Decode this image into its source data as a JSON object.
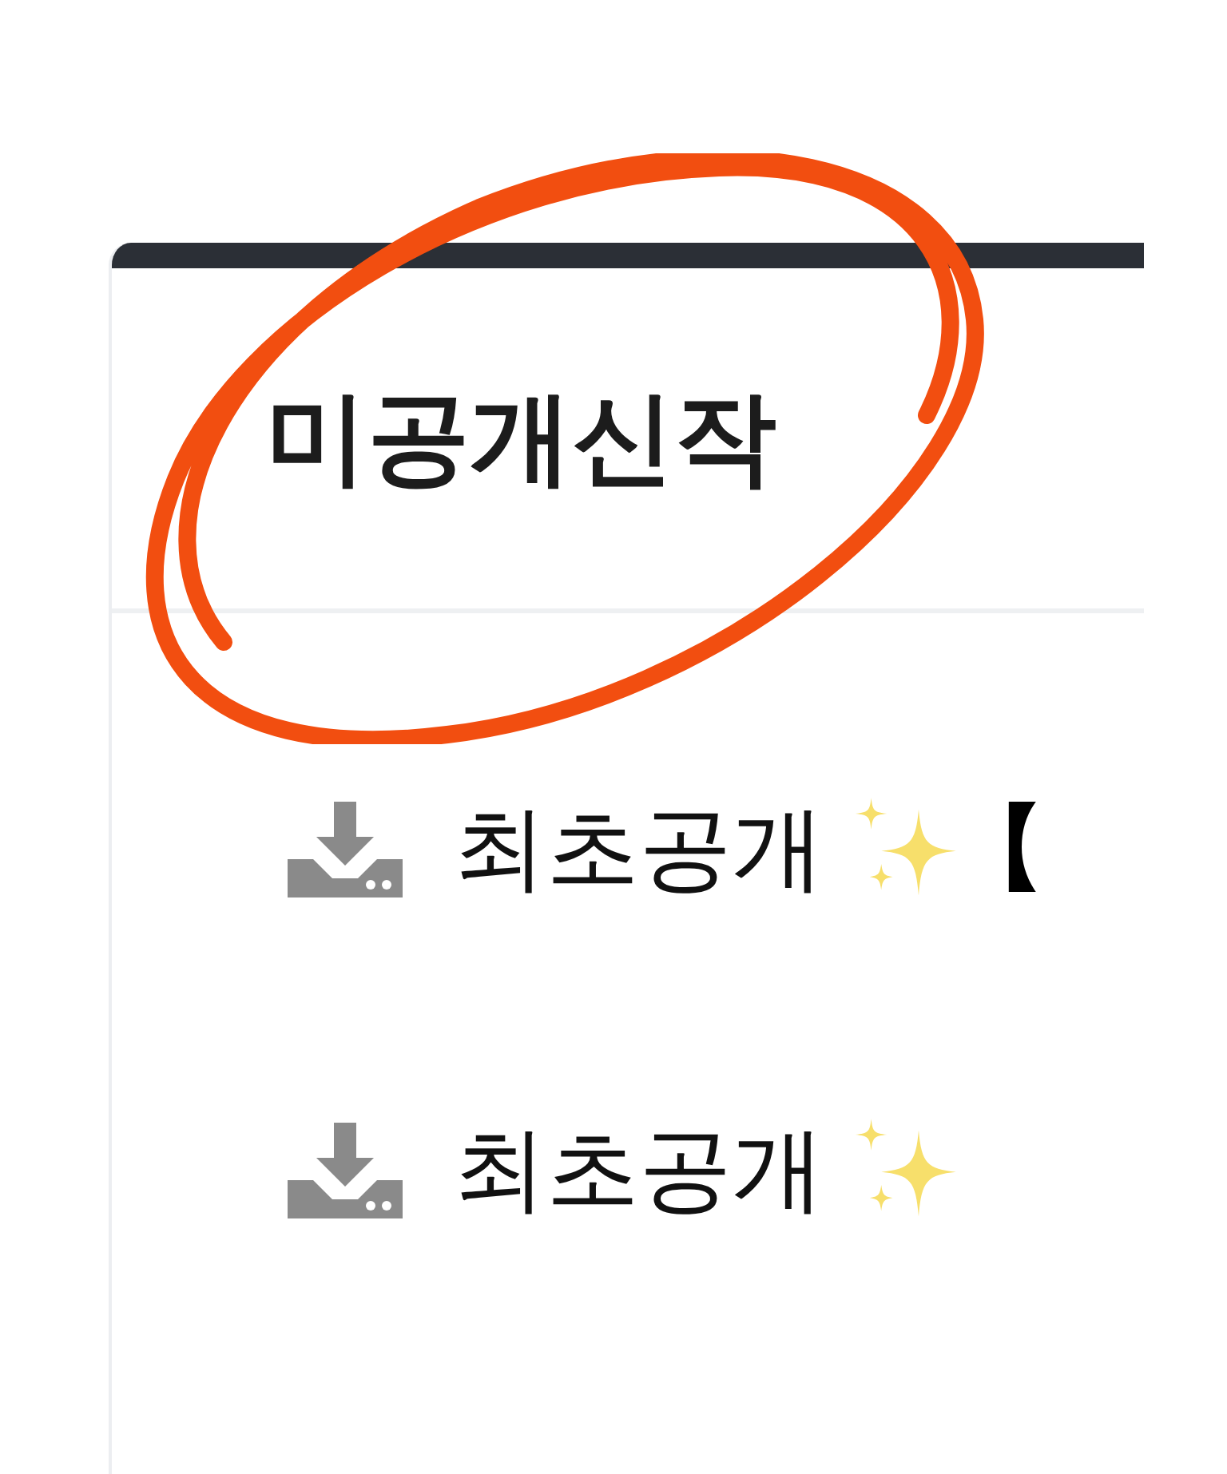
{
  "section": {
    "title": "미공개신작"
  },
  "items": [
    {
      "label": "최초공개",
      "title": "【"
    },
    {
      "label": "최초공개"
    }
  ]
}
